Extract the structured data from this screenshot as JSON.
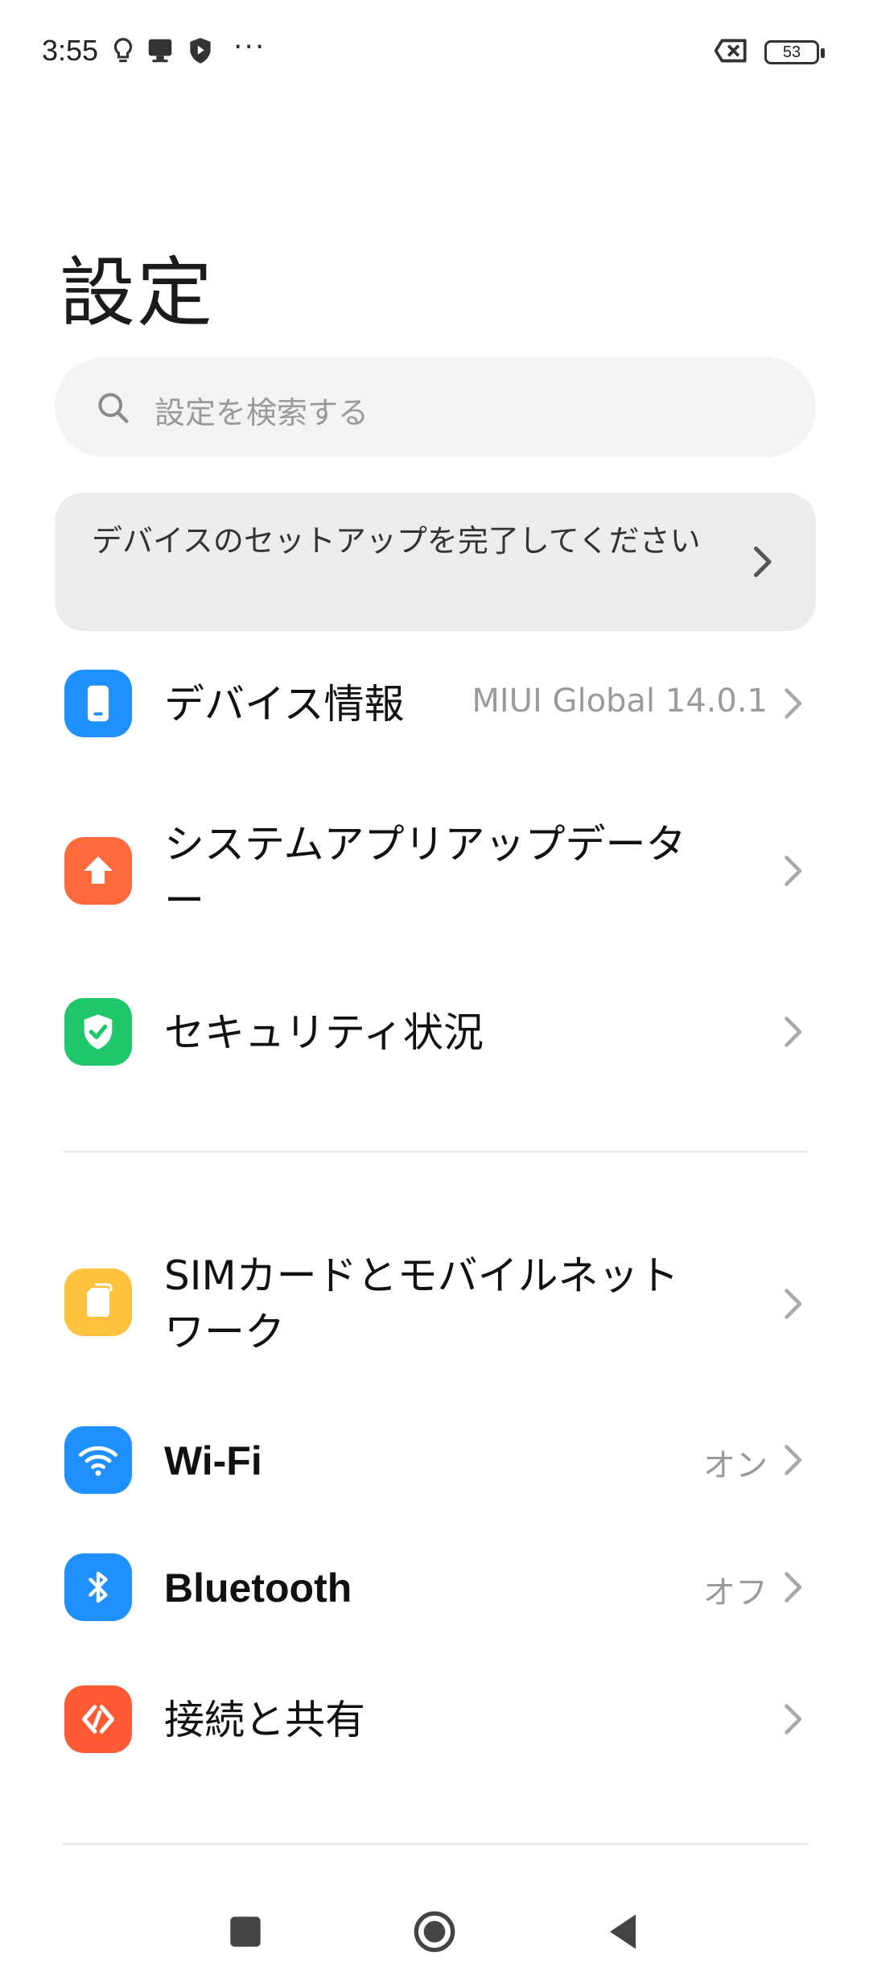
{
  "status_bar": {
    "time": "3:55",
    "battery": "53",
    "more": "···",
    "icons": [
      "bulb-icon",
      "desktop-icon",
      "shield-play-icon",
      "no-sim-icon"
    ]
  },
  "page": {
    "title": "設定"
  },
  "search": {
    "placeholder": "設定を検索する",
    "icon": "search-icon"
  },
  "banner": {
    "text": "デバイスのセットアップを完了してください"
  },
  "settings": [
    {
      "label": "デバイス情報",
      "value": "MIUI Global 14.0.1",
      "icon": "phone-icon",
      "color": "#1e90ff"
    },
    {
      "label": "システムアプリアップデーター",
      "value": "",
      "icon": "arrow-up-icon",
      "color": "#ff6a3d"
    },
    {
      "label": "セキュリティ状況",
      "value": "",
      "icon": "shield-check-icon",
      "color": "#1ec76a"
    },
    {
      "label": "SIMカードとモバイルネットワーク",
      "value": "",
      "icon": "sim-card-icon",
      "color": "#ffc23d"
    },
    {
      "label": "Wi-Fi",
      "value": "オン",
      "icon": "wifi-icon",
      "color": "#1e90ff"
    },
    {
      "label": "Bluetooth",
      "value": "オフ",
      "icon": "bluetooth-icon",
      "color": "#1e90ff"
    },
    {
      "label": "接続と共有",
      "value": "",
      "icon": "share-icon",
      "color": "#ff5a36"
    }
  ],
  "nav_bar": {
    "buttons": [
      "recents-button",
      "home-button",
      "back-button"
    ]
  },
  "colors": {
    "accent": "#1e90ff",
    "background": "#ffffff",
    "secondary_text": "#9a9a9a"
  }
}
